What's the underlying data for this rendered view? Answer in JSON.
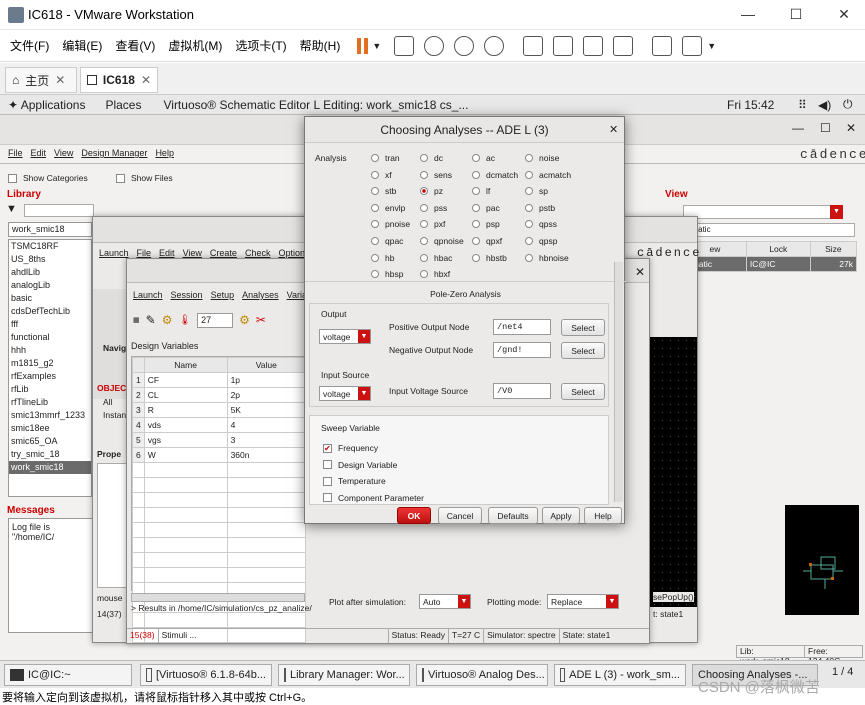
{
  "vmware": {
    "title": "IC618 - VMware Workstation",
    "menus": [
      "文件(F)",
      "编辑(E)",
      "查看(V)",
      "虚拟机(M)",
      "选项卡(T)",
      "帮助(H)"
    ],
    "tabs": [
      {
        "label": "主页"
      },
      {
        "label": "IC618"
      }
    ]
  },
  "gnome": {
    "applications": "Applications",
    "places": "Places",
    "window": "Virtuoso® Schematic Editor L Editing: work_smic18 cs_...",
    "clock": "Fri 15:42"
  },
  "library_manager": {
    "menus": [
      "File",
      "Edit",
      "View",
      "Design Manager",
      "Help"
    ],
    "brand": "cādence",
    "show_categories": "Show Categories",
    "show_files": "Show Files",
    "library_label": "Library",
    "library_value": "work_smic18",
    "libraries": [
      "TSMC18RF",
      "US_8ths",
      "ahdlLib",
      "analogLib",
      "basic",
      "cdsDefTechLib",
      "fff",
      "functional",
      "hhh",
      "m1815_g2",
      "rfExamples",
      "rfLib",
      "rfTlineLib",
      "smic13mmrf_1233",
      "smic18ee",
      "smic65_OA",
      "try_smic_18",
      "work_smic18"
    ],
    "selected_library": "work_smic18",
    "view_label": "View",
    "view_columns": [
      "ew",
      "Lock",
      "Size"
    ],
    "view_row": [
      "ematic",
      "IC@IC",
      "27k"
    ],
    "messages_label": "Messages",
    "log_text": "Log file is \"/home/IC/",
    "status_lib": "Lib: work_smic18",
    "status_free": "Free: 134.40G"
  },
  "analog_design": {
    "title": "Virtuoso® Analog Design",
    "menus": [
      "Launch",
      "File",
      "Edit",
      "View",
      "Create",
      "Check",
      "Option"
    ]
  },
  "ade_l": {
    "title": "ADE L",
    "menus": [
      "Launch",
      "Session",
      "Setup",
      "Analyses",
      "Varia"
    ],
    "temp": "27",
    "design_vars_label": "Design Variables",
    "var_columns": [
      "Name",
      "Value"
    ],
    "variables": [
      {
        "n": "1",
        "name": "CF",
        "value": "1p"
      },
      {
        "n": "2",
        "name": "CL",
        "value": "2p"
      },
      {
        "n": "3",
        "name": "R",
        "value": "5K"
      },
      {
        "n": "4",
        "name": "vds",
        "value": "4"
      },
      {
        "n": "5",
        "name": "vgs",
        "value": "3"
      },
      {
        "n": "6",
        "name": "W",
        "value": "360n"
      }
    ],
    "results_text": "> Results in /home/IC/simulation/cs_pz_analize/",
    "plot_after_label": "Plot after simulation:",
    "plot_after_value": "Auto",
    "plotting_mode_label": "Plotting mode:",
    "plotting_mode_value": "Replace",
    "status_count": "15(38)",
    "status_stimuli": "Stimuli ...",
    "status": "Status: Ready",
    "temperature": "T=27 C",
    "simulator": "Simulator: spectre",
    "state": "State: state1",
    "left_count": "14(37)",
    "nav_label": "Navig",
    "objects_label": "OBJEC",
    "all_label": "All",
    "instances_label": "Instanc",
    "props_label": "Prope",
    "mouse_label": "mouse",
    "popup_text": "sePopUp()",
    "state_small": "t: state1"
  },
  "dialog": {
    "title": "Choosing Analyses -- ADE L (3)",
    "analysis_label": "Analysis",
    "analyses": [
      "tran",
      "dc",
      "ac",
      "noise",
      "xf",
      "sens",
      "dcmatch",
      "acmatch",
      "stb",
      "pz",
      "lf",
      "sp",
      "envlp",
      "pss",
      "pac",
      "pstb",
      "pnoise",
      "pxf",
      "psp",
      "qpss",
      "qpac",
      "qpnoise",
      "qpxf",
      "qpsp",
      "hb",
      "hbac",
      "hbstb",
      "hbnoise",
      "hbsp",
      "hbxf"
    ],
    "selected": "pz",
    "section_title": "Pole-Zero Analysis",
    "output_label": "Output",
    "output_type": "voltage",
    "pos_label": "Positive Output Node",
    "pos_value": "/net4",
    "neg_label": "Negative Output Node",
    "neg_value": "/gnd!",
    "input_label": "Input Source",
    "input_type": "voltage",
    "input_vs_label": "Input Voltage Source",
    "input_vs_value": "/V0",
    "select_label": "Select",
    "sweep_label": "Sweep Variable",
    "sweep_options": [
      {
        "label": "Frequency",
        "checked": true
      },
      {
        "label": "Design Variable",
        "checked": false
      },
      {
        "label": "Temperature",
        "checked": false
      },
      {
        "label": "Component Parameter",
        "checked": false
      }
    ],
    "buttons": {
      "ok": "OK",
      "cancel": "Cancel",
      "defaults": "Defaults",
      "apply": "Apply",
      "help": "Help"
    }
  },
  "taskbar": {
    "items": [
      "IC@IC:~",
      "[Virtuoso® 6.1.8-64b...",
      "Library Manager: Wor...",
      "Virtuoso® Analog Des...",
      "ADE L (3) - work_sm...",
      "Choosing Analyses -..."
    ],
    "page": "1 / 4"
  },
  "ime_hint": "要将输入定向到该虚拟机，请将鼠标指针移入其中或按 Ctrl+G。",
  "watermark": "CSDN @落枫微苦"
}
